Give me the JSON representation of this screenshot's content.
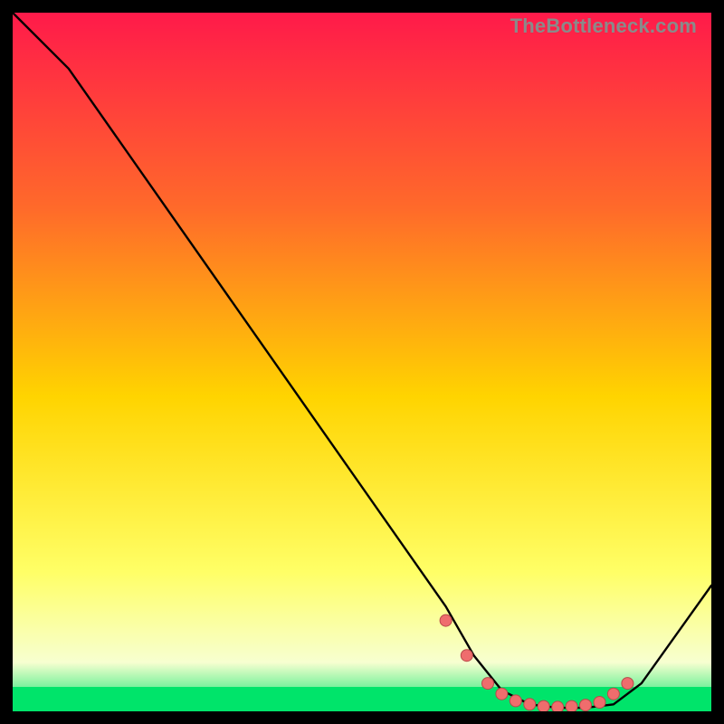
{
  "watermark": "TheBottleneck.com",
  "colors": {
    "gradient_top": "#ff1a4a",
    "gradient_mid_upper": "#ff6a2a",
    "gradient_mid": "#ffd400",
    "gradient_mid_lower": "#ffff66",
    "gradient_low": "#f7ffd0",
    "gradient_bottom": "#00e46a",
    "curve": "#000000",
    "marker_fill": "#ef6d6d",
    "marker_stroke": "#b84a4a"
  },
  "chart_data": {
    "type": "line",
    "title": "",
    "xlabel": "",
    "ylabel": "",
    "xlim": [
      0,
      100
    ],
    "ylim": [
      0,
      100
    ],
    "curve": {
      "x": [
        0,
        8,
        62,
        66,
        70,
        74,
        78,
        82,
        86,
        90,
        100
      ],
      "y": [
        100,
        92,
        15,
        8,
        3,
        1,
        0.5,
        0.5,
        1,
        4,
        18
      ]
    },
    "markers": {
      "x": [
        62,
        65,
        68,
        70,
        72,
        74,
        76,
        78,
        80,
        82,
        84,
        86,
        88
      ],
      "y": [
        13,
        8,
        4,
        2.5,
        1.5,
        1,
        0.7,
        0.6,
        0.7,
        0.9,
        1.3,
        2.5,
        4
      ]
    },
    "green_band": {
      "y_from": 0,
      "y_to": 3.5
    }
  }
}
